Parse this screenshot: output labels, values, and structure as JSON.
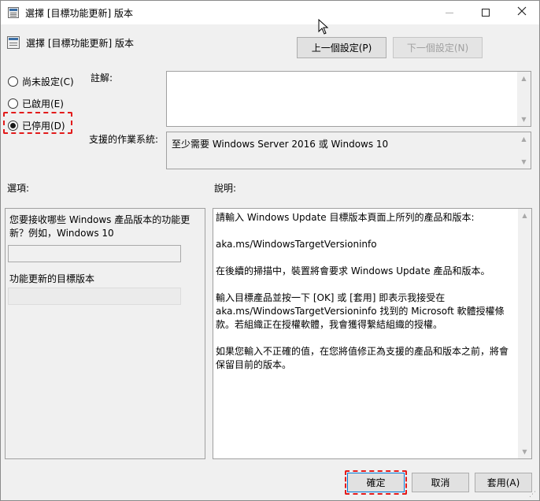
{
  "window": {
    "title": "選擇 [目標功能更新] 版本",
    "minimize_icon": "minimize-icon",
    "maximize_icon": "maximize-icon",
    "close_icon": "close-icon"
  },
  "header": {
    "policy_name": "選擇 [目標功能更新] 版本",
    "prev_label": "上一個設定(P)",
    "next_label": "下一個設定(N)"
  },
  "state": {
    "options": [
      {
        "label": "尚未設定(C)",
        "checked": false
      },
      {
        "label": "已啟用(E)",
        "checked": false
      },
      {
        "label": "已停用(D)",
        "checked": true
      }
    ]
  },
  "comment": {
    "label": "註解:",
    "value": ""
  },
  "supported": {
    "label": "支援的作業系統:",
    "value": "至少需要 Windows Server 2016 或 Windows 10"
  },
  "options_section": {
    "label": "選項:",
    "question": "您要接收哪些 Windows 產品版本的功能更新？例如，Windows 10",
    "product_value": "",
    "version_label": "功能更新的目標版本",
    "version_value": ""
  },
  "help_section": {
    "label": "說明:",
    "paragraphs": [
      "請輸入 Windows Update 目標版本頁面上所列的產品和版本:",
      "aka.ms/WindowsTargetVersioninfo",
      "在後續的掃描中，裝置將會要求 Windows Update 產品和版本。",
      "輸入目標產品並按一下 [OK] 或 [套用] 即表示我接受在 aka.ms/WindowsTargetVersioninfo 找到的 Microsoft 軟體授權條款。若組織正在授權軟體，我會獲得繫結組織的授權。",
      "如果您輸入不正確的值，在您將值修正為支援的產品和版本之前，將會保留目前的版本。"
    ]
  },
  "footer": {
    "ok_label": "確定",
    "cancel_label": "取消",
    "apply_label": "套用(A)"
  },
  "colors": {
    "highlight": "#e21b1b",
    "background": "#f0f0f0",
    "focus": "#0078d7"
  }
}
